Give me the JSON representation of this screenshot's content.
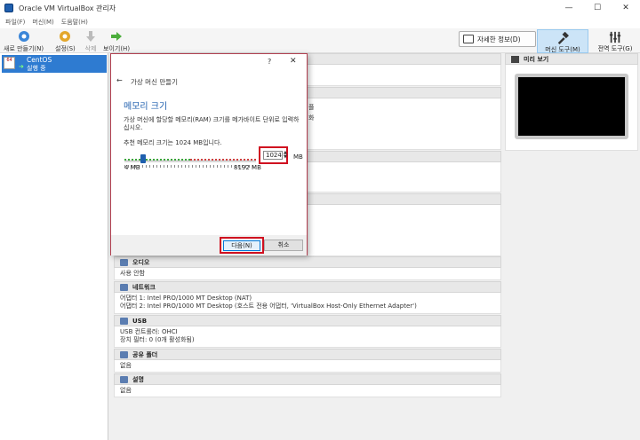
{
  "window": {
    "title": "Oracle VM VirtualBox 관리자",
    "minimize": "—",
    "maximize": "☐",
    "close": "✕"
  },
  "menu": [
    "파일(F)",
    "머신(M)",
    "도움말(H)"
  ],
  "toolbar": {
    "new": "새로 만들기(N)",
    "settings": "설정(S)",
    "discard": "삭제",
    "show": "보이기(H)",
    "details": "자세한 정보(D)",
    "machine_tools": "머신 도구(M)",
    "global_tools": "전역 도구(G)"
  },
  "vm": {
    "name": "CentOS",
    "state": "실행 중",
    "badge": "64"
  },
  "sections": {
    "system_tail": "플",
    "display_line": "화",
    "audio": {
      "title": "오디오",
      "line": "사용 안함"
    },
    "network": {
      "title": "네트워크",
      "lines": [
        "어댑터 1:  Intel PRO/1000 MT Desktop (NAT)",
        "어댑터 2:  Intel PRO/1000 MT Desktop (호스트 전용 어댑터, 'VirtualBox Host-Only Ethernet Adapter')"
      ]
    },
    "usb": {
      "title": "USB",
      "lines": [
        "USB 컨트롤러:  OHCI",
        "장치 필터:       0 (0개 활성화됨)"
      ]
    },
    "shared": {
      "title": "공유 폴더",
      "line": "없음"
    },
    "description": {
      "title": "설명",
      "line": "없음"
    }
  },
  "preview": {
    "title": "미리 보기"
  },
  "dialog": {
    "help": "?",
    "close": "✕",
    "back": "←",
    "title": "가상 머신 만들기",
    "page": "메모리 크기",
    "description": "가상 머신에 할당할 메모리(RAM) 크기를 메가바이트 단위로 입력하십시오.",
    "recommended": "추천 메모리 크기는 1024 MB입니다.",
    "memory_value": "1024",
    "memory_min_mb": 4,
    "memory_max_mb": 8192,
    "memory_slider_max_mb": 16384,
    "unit": "MB",
    "min_label": "4 MB",
    "max_label": "8192 MB",
    "next": "다음(N)",
    "cancel": "취소"
  },
  "colors": {
    "accent": "#1f5fae",
    "selection": "#2e7bd1",
    "highlight": "#d01020"
  }
}
